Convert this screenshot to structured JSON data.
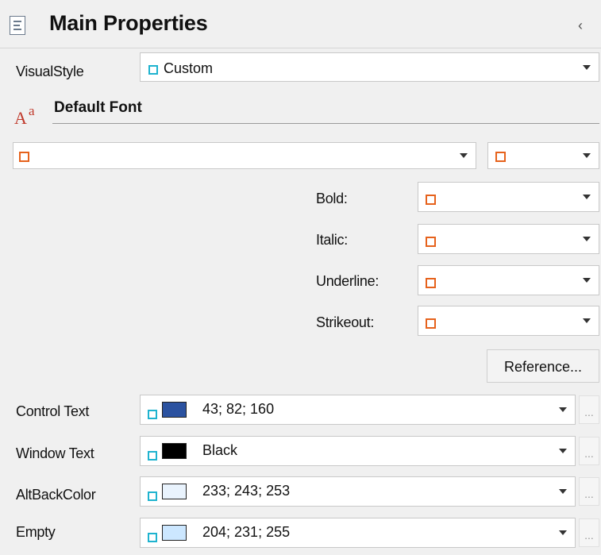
{
  "panel": {
    "title": "Main Properties",
    "collapse_glyph": "‹"
  },
  "visual_style": {
    "label": "VisualStyle",
    "value": "Custom"
  },
  "default_font": {
    "heading": "Default Font",
    "icon_glyph_big": "A",
    "icon_glyph_small": "a"
  },
  "font_styles": [
    {
      "label": "Bold:"
    },
    {
      "label": "Italic:"
    },
    {
      "label": "Underline:"
    },
    {
      "label": "Strikeout:"
    }
  ],
  "reference_button": {
    "label": "Reference..."
  },
  "colors": [
    {
      "label": "Control Text",
      "value": "43; 82; 160",
      "swatch": "#2b52a0"
    },
    {
      "label": "Window Text",
      "value": "Black",
      "swatch": "#000000"
    },
    {
      "label": "AltBackColor",
      "value": "233; 243; 253",
      "swatch": "#e9f3fd"
    },
    {
      "label": "Empty",
      "value": "204; 231; 255",
      "swatch": "#cce7ff"
    }
  ],
  "ellipsis_label": "..."
}
